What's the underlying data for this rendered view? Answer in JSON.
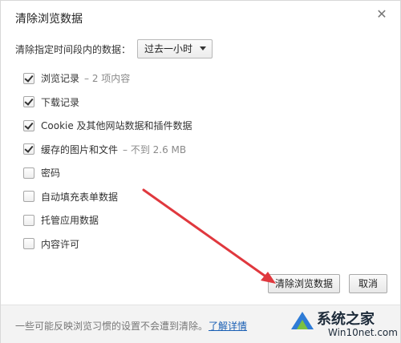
{
  "dialog": {
    "title": "清除浏览数据",
    "close_icon": "close-icon"
  },
  "period": {
    "label": "清除指定时间段内的数据：",
    "selected": "过去一小时"
  },
  "options": [
    {
      "label": "浏览记录",
      "detail": "– 2 项内容",
      "checked": true
    },
    {
      "label": "下载记录",
      "detail": "",
      "checked": true
    },
    {
      "label": "Cookie 及其他网站数据和插件数据",
      "detail": "",
      "checked": true
    },
    {
      "label": "缓存的图片和文件",
      "detail": "– 不到 2.6 MB",
      "checked": true
    },
    {
      "label": "密码",
      "detail": "",
      "checked": false
    },
    {
      "label": "自动填充表单数据",
      "detail": "",
      "checked": false
    },
    {
      "label": "托管应用数据",
      "detail": "",
      "checked": false
    },
    {
      "label": "内容许可",
      "detail": "",
      "checked": false
    }
  ],
  "buttons": {
    "clear": "清除浏览数据",
    "cancel": "取消"
  },
  "footer": {
    "text": "一些可能反映浏览习惯的设置不会遭到清除。",
    "link": "了解详情"
  },
  "watermark": {
    "title": "系统之家",
    "url": "Win10net.com"
  },
  "colors": {
    "annotation_arrow": "#e0383e",
    "link": "#1a5fb4"
  }
}
